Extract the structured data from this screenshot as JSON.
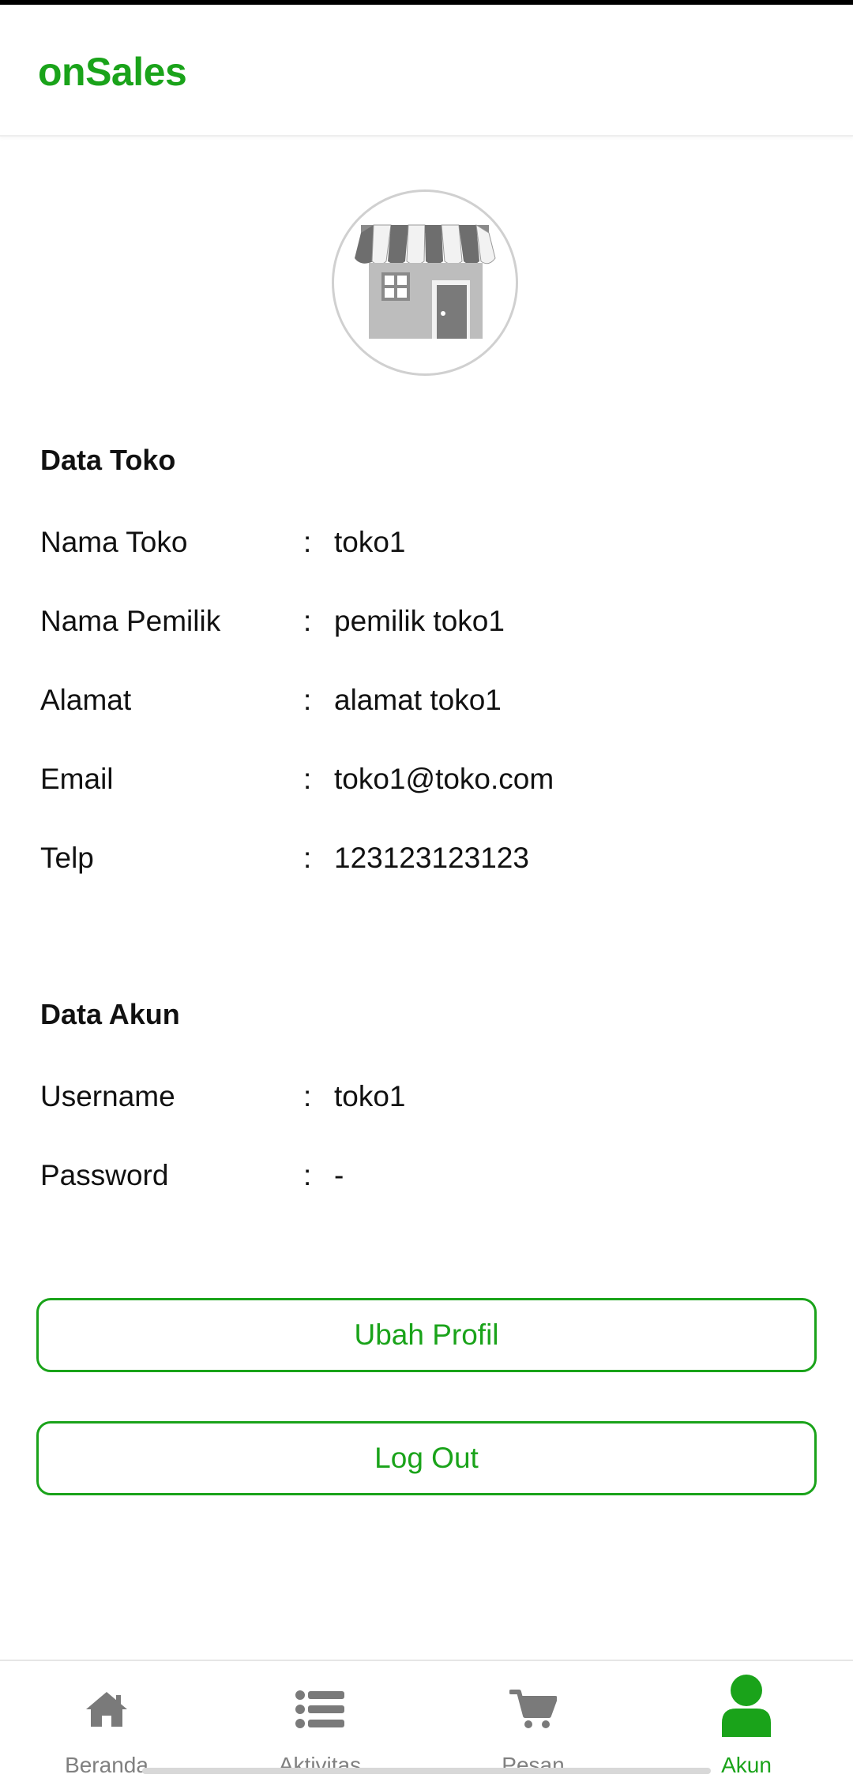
{
  "app": {
    "title": "onSales",
    "accent_color": "#1aa31a"
  },
  "profile": {
    "avatar_icon": "store-icon"
  },
  "store_section": {
    "title": "Data Toko",
    "rows": [
      {
        "label": "Nama Toko",
        "value": "toko1"
      },
      {
        "label": "Nama Pemilik",
        "value": "pemilik toko1"
      },
      {
        "label": "Alamat",
        "value": "alamat toko1"
      },
      {
        "label": "Email",
        "value": "toko1@toko.com"
      },
      {
        "label": "Telp",
        "value": "123123123123"
      }
    ]
  },
  "account_section": {
    "title": "Data Akun",
    "rows": [
      {
        "label": "Username",
        "value": "toko1"
      },
      {
        "label": "Password",
        "value": "-"
      }
    ]
  },
  "separator": ":",
  "actions": {
    "edit_profile_label": "Ubah Profil",
    "logout_label": "Log Out"
  },
  "bottom_nav": {
    "items": [
      {
        "label": "Beranda",
        "icon": "home-icon",
        "active": false
      },
      {
        "label": "Aktivitas",
        "icon": "list-icon",
        "active": false
      },
      {
        "label": "Pesan",
        "icon": "cart-icon",
        "active": false
      },
      {
        "label": "Akun",
        "icon": "user-icon",
        "active": true
      }
    ],
    "active_color": "#1aa31a",
    "inactive_color": "#808080"
  }
}
